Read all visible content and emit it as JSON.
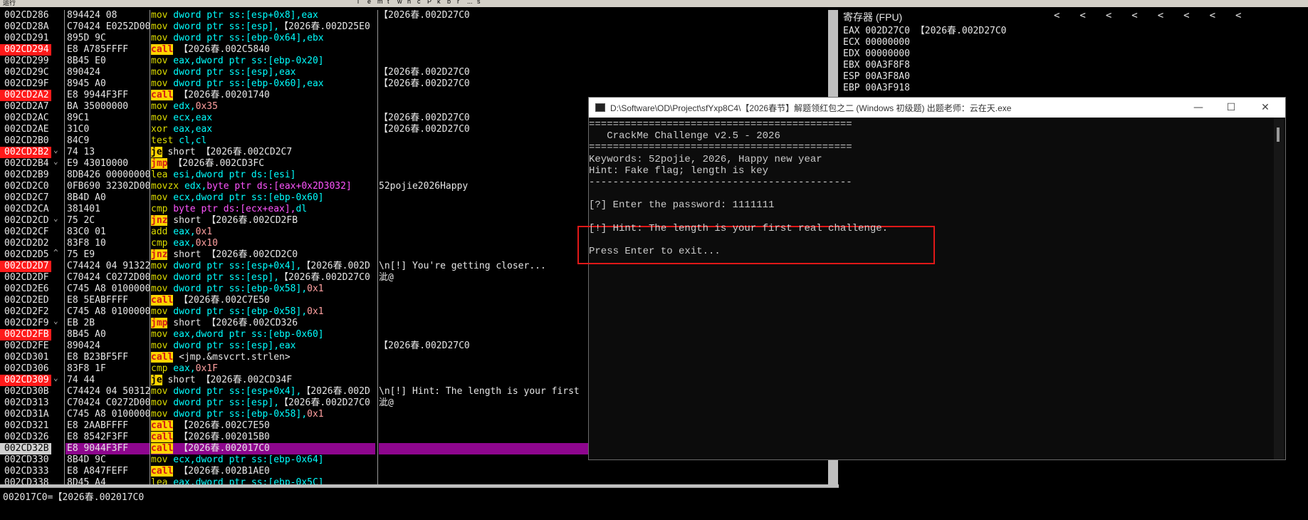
{
  "toolbar": {
    "mode_label": "运行",
    "letters": [
      "l",
      "e",
      "m",
      "t",
      "w",
      "h",
      "c",
      "P",
      "k",
      "b",
      "r",
      "...",
      "s"
    ]
  },
  "cpu": {
    "rows": [
      {
        "addr": "002CD286",
        "hex": "894424 08",
        "bp": false,
        "mark": "",
        "dis": [
          [
            "mn",
            "mov"
          ],
          [
            "op",
            " dword ptr ss:[esp+0x8],"
          ],
          [
            "op",
            "eax"
          ]
        ],
        "comment": "【2026春.002D27C0"
      },
      {
        "addr": "002CD28A",
        "hex": "C70424 E0252D00",
        "bp": false,
        "mark": "",
        "dis": [
          [
            "mn",
            "mov"
          ],
          [
            "op",
            " dword ptr ss:[esp],"
          ],
          [
            "str",
            "【2026春.002D25E0"
          ]
        ],
        "comment": ""
      },
      {
        "addr": "002CD291",
        "hex": "895D 9C",
        "bp": false,
        "mark": "",
        "dis": [
          [
            "mn",
            "mov"
          ],
          [
            "op",
            " dword ptr ss:[ebp-0x64],"
          ],
          [
            "op",
            "ebx"
          ]
        ],
        "comment": ""
      },
      {
        "addr": "002CD294",
        "hex": "E8 A785FFFF",
        "bp": true,
        "mark": "",
        "dis": [
          [
            "call",
            "call"
          ],
          [
            "str",
            " 【2026春.002C5840"
          ]
        ],
        "comment": ""
      },
      {
        "addr": "002CD299",
        "hex": "8B45 E0",
        "bp": false,
        "mark": "",
        "dis": [
          [
            "mn",
            "mov"
          ],
          [
            "op",
            " eax,dword ptr ss:[ebp-0x20]"
          ]
        ],
        "comment": ""
      },
      {
        "addr": "002CD29C",
        "hex": "890424",
        "bp": false,
        "mark": "",
        "dis": [
          [
            "mn",
            "mov"
          ],
          [
            "op",
            " dword ptr ss:[esp],"
          ],
          [
            "op",
            "eax"
          ]
        ],
        "comment": "【2026春.002D27C0"
      },
      {
        "addr": "002CD29F",
        "hex": "8945 A0",
        "bp": false,
        "mark": "",
        "dis": [
          [
            "mn",
            "mov"
          ],
          [
            "op",
            " dword ptr ss:[ebp-0x60],"
          ],
          [
            "op",
            "eax"
          ]
        ],
        "comment": "【2026春.002D27C0"
      },
      {
        "addr": "002CD2A2",
        "hex": "E8 9944F3FF",
        "bp": true,
        "mark": "",
        "dis": [
          [
            "call",
            "call"
          ],
          [
            "str",
            " 【2026春.00201740"
          ]
        ],
        "comment": ""
      },
      {
        "addr": "002CD2A7",
        "hex": "BA 35000000",
        "bp": false,
        "mark": "",
        "dis": [
          [
            "mn",
            "mov"
          ],
          [
            "op",
            " edx,"
          ],
          [
            "imm",
            "0x35"
          ]
        ],
        "comment": ""
      },
      {
        "addr": "002CD2AC",
        "hex": "89C1",
        "bp": false,
        "mark": "",
        "dis": [
          [
            "mn",
            "mov"
          ],
          [
            "op",
            " ecx,eax"
          ]
        ],
        "comment": "【2026春.002D27C0"
      },
      {
        "addr": "002CD2AE",
        "hex": "31C0",
        "bp": false,
        "mark": "",
        "dis": [
          [
            "mn",
            "xor"
          ],
          [
            "op",
            " eax,eax"
          ]
        ],
        "comment": "【2026春.002D27C0"
      },
      {
        "addr": "002CD2B0",
        "hex": "84C9",
        "bp": false,
        "mark": "",
        "dis": [
          [
            "mn",
            "test"
          ],
          [
            "op",
            " cl,cl"
          ]
        ],
        "comment": ""
      },
      {
        "addr": "002CD2B2",
        "hex": "74 13",
        "bp": true,
        "mark": "⌄",
        "dis": [
          [
            "je",
            "je"
          ],
          [
            "str",
            " short 【2026春.002CD2C7"
          ]
        ],
        "comment": ""
      },
      {
        "addr": "002CD2B4",
        "hex": "E9 43010000",
        "bp": false,
        "mark": "⌄",
        "dis": [
          [
            "jmp",
            "jmp"
          ],
          [
            "str",
            " 【2026春.002CD3FC"
          ]
        ],
        "comment": ""
      },
      {
        "addr": "002CD2B9",
        "hex": "8DB426 00000000",
        "bp": false,
        "mark": "",
        "dis": [
          [
            "mn",
            "lea"
          ],
          [
            "op",
            " esi,dword ptr ds:[esi]"
          ]
        ],
        "comment": ""
      },
      {
        "addr": "002CD2C0",
        "hex": "0FB690 32302D00",
        "bp": false,
        "mark": "",
        "dis": [
          [
            "mn",
            "movzx"
          ],
          [
            "op",
            " edx,"
          ],
          [
            "mag",
            "byte ptr ds:[eax+0x2D3032]"
          ]
        ],
        "comment": "52pojie2026Happy"
      },
      {
        "addr": "002CD2C7",
        "hex": "8B4D A0",
        "bp": false,
        "mark": "",
        "dis": [
          [
            "mn",
            "mov"
          ],
          [
            "op",
            " ecx,dword ptr ss:[ebp-0x60]"
          ]
        ],
        "comment": ""
      },
      {
        "addr": "002CD2CA",
        "hex": "381401",
        "bp": false,
        "mark": "",
        "dis": [
          [
            "mn",
            "cmp"
          ],
          [
            "mag",
            " byte ptr ds:[ecx+eax],"
          ],
          [
            "op",
            "dl"
          ]
        ],
        "comment": ""
      },
      {
        "addr": "002CD2CD",
        "hex": "75 2C",
        "bp": false,
        "mark": "⌄",
        "dis": [
          [
            "jmp",
            "jnz"
          ],
          [
            "str",
            " short 【2026春.002CD2FB"
          ]
        ],
        "comment": ""
      },
      {
        "addr": "002CD2CF",
        "hex": "83C0 01",
        "bp": false,
        "mark": "",
        "dis": [
          [
            "mn",
            "add"
          ],
          [
            "op",
            " eax,"
          ],
          [
            "imm",
            "0x1"
          ]
        ],
        "comment": ""
      },
      {
        "addr": "002CD2D2",
        "hex": "83F8 10",
        "bp": false,
        "mark": "",
        "dis": [
          [
            "mn",
            "cmp"
          ],
          [
            "op",
            " eax,"
          ],
          [
            "imm",
            "0x10"
          ]
        ],
        "comment": ""
      },
      {
        "addr": "002CD2D5",
        "hex": "75 E9",
        "bp": false,
        "mark": "^",
        "dis": [
          [
            "jmp",
            "jnz"
          ],
          [
            "str",
            " short 【2026春.002CD2C0"
          ]
        ],
        "comment": ""
      },
      {
        "addr": "002CD2D7",
        "hex": "C74424 04 91322D",
        "bp": true,
        "mark": "",
        "dis": [
          [
            "mn",
            "mov"
          ],
          [
            "op",
            " dword ptr ss:[esp+0x4],"
          ],
          [
            "str",
            "【2026春.002D"
          ]
        ],
        "comment": "\\n[!] You're getting closer..."
      },
      {
        "addr": "002CD2DF",
        "hex": "C70424 C0272D00",
        "bp": false,
        "mark": "",
        "dis": [
          [
            "mn",
            "mov"
          ],
          [
            "op",
            " dword ptr ss:[esp],"
          ],
          [
            "str",
            "【2026春.002D27C0"
          ]
        ],
        "comment": "泚@"
      },
      {
        "addr": "002CD2E6",
        "hex": "C745 A8 01000000",
        "bp": false,
        "mark": "",
        "dis": [
          [
            "mn",
            "mov"
          ],
          [
            "op",
            " dword ptr ss:[ebp-0x58],"
          ],
          [
            "imm",
            "0x1"
          ]
        ],
        "comment": ""
      },
      {
        "addr": "002CD2ED",
        "hex": "E8 5EABFFFF",
        "bp": false,
        "mark": "",
        "dis": [
          [
            "call",
            "call"
          ],
          [
            "str",
            " 【2026春.002C7E50"
          ]
        ],
        "comment": ""
      },
      {
        "addr": "002CD2F2",
        "hex": "C745 A8 01000000",
        "bp": false,
        "mark": "",
        "dis": [
          [
            "mn",
            "mov"
          ],
          [
            "op",
            " dword ptr ss:[ebp-0x58],"
          ],
          [
            "imm",
            "0x1"
          ]
        ],
        "comment": ""
      },
      {
        "addr": "002CD2F9",
        "hex": "EB 2B",
        "bp": false,
        "mark": "⌄",
        "dis": [
          [
            "jmp",
            "jmp"
          ],
          [
            "str",
            " short 【2026春.002CD326"
          ]
        ],
        "comment": ""
      },
      {
        "addr": "002CD2FB",
        "hex": "8B45 A0",
        "bp": true,
        "mark": "",
        "dis": [
          [
            "mn",
            "mov"
          ],
          [
            "op",
            " eax,dword ptr ss:[ebp-0x60]"
          ]
        ],
        "comment": ""
      },
      {
        "addr": "002CD2FE",
        "hex": "890424",
        "bp": false,
        "mark": "",
        "dis": [
          [
            "mn",
            "mov"
          ],
          [
            "op",
            " dword ptr ss:[esp],"
          ],
          [
            "op",
            "eax"
          ]
        ],
        "comment": "【2026春.002D27C0"
      },
      {
        "addr": "002CD301",
        "hex": "E8 B23BF5FF",
        "bp": false,
        "mark": "",
        "dis": [
          [
            "call",
            "call"
          ],
          [
            "str",
            " <jmp.&msvcrt.strlen>"
          ]
        ],
        "comment": ""
      },
      {
        "addr": "002CD306",
        "hex": "83F8 1F",
        "bp": false,
        "mark": "",
        "dis": [
          [
            "mn",
            "cmp"
          ],
          [
            "op",
            " eax,"
          ],
          [
            "imm",
            "0x1F"
          ]
        ],
        "comment": ""
      },
      {
        "addr": "002CD309",
        "hex": "74 44",
        "bp": true,
        "mark": "⌄",
        "dis": [
          [
            "je",
            "je"
          ],
          [
            "str",
            " short 【2026春.002CD34F"
          ]
        ],
        "comment": ""
      },
      {
        "addr": "002CD30B",
        "hex": "C74424 04 503120",
        "bp": false,
        "mark": "",
        "dis": [
          [
            "mn",
            "mov"
          ],
          [
            "op",
            " dword ptr ss:[esp+0x4],"
          ],
          [
            "str",
            "【2026春.002D"
          ]
        ],
        "comment": "\\n[!] Hint: The length is your first"
      },
      {
        "addr": "002CD313",
        "hex": "C70424 C0272D00",
        "bp": false,
        "mark": "",
        "dis": [
          [
            "mn",
            "mov"
          ],
          [
            "op",
            " dword ptr ss:[esp],"
          ],
          [
            "str",
            "【2026春.002D27C0"
          ]
        ],
        "comment": "泚@"
      },
      {
        "addr": "002CD31A",
        "hex": "C745 A8 01000000",
        "bp": false,
        "mark": "",
        "dis": [
          [
            "mn",
            "mov"
          ],
          [
            "op",
            " dword ptr ss:[ebp-0x58],"
          ],
          [
            "imm",
            "0x1"
          ]
        ],
        "comment": ""
      },
      {
        "addr": "002CD321",
        "hex": "E8 2AABFFFF",
        "bp": false,
        "mark": "",
        "dis": [
          [
            "call",
            "call"
          ],
          [
            "str",
            " 【2026春.002C7E50"
          ]
        ],
        "comment": ""
      },
      {
        "addr": "002CD326",
        "hex": "E8 8542F3FF",
        "bp": false,
        "mark": "",
        "dis": [
          [
            "call",
            "call"
          ],
          [
            "str",
            " 【2026春.002015B0"
          ]
        ],
        "comment": ""
      },
      {
        "addr": "002CD32B",
        "hex": "E8 9044F3FF",
        "bp": false,
        "mark": "",
        "sel": true,
        "dis": [
          [
            "call",
            "call"
          ],
          [
            "str",
            " 【2026春.002017C0"
          ]
        ],
        "comment": ""
      },
      {
        "addr": "002CD330",
        "hex": "8B4D 9C",
        "bp": false,
        "mark": "",
        "dis": [
          [
            "mn",
            "mov"
          ],
          [
            "op",
            " ecx,dword ptr ss:[ebp-0x64]"
          ]
        ],
        "comment": ""
      },
      {
        "addr": "002CD333",
        "hex": "E8 A847FEFF",
        "bp": false,
        "mark": "",
        "dis": [
          [
            "call",
            "call"
          ],
          [
            "str",
            " 【2026春.002B1AE0"
          ]
        ],
        "comment": ""
      },
      {
        "addr": "002CD338",
        "hex": "8D45 A4",
        "bp": false,
        "mark": "",
        "dis": [
          [
            "mn",
            "lea"
          ],
          [
            "op",
            " eax,dword ptr ss:[ebp-0x5C]"
          ]
        ],
        "comment": ""
      }
    ]
  },
  "info": {
    "line": "002017C0=【2026春.002017C0"
  },
  "registers": {
    "title": "寄存器 (FPU)",
    "arrows": "<<<<<<<<",
    "rows": [
      {
        "name": "EAX",
        "value": "002D27C0 【2026春.002D27C0"
      },
      {
        "name": "ECX",
        "value": "00000000"
      },
      {
        "name": "EDX",
        "value": "00000000"
      },
      {
        "name": "EBX",
        "value": "00A3F8F8"
      },
      {
        "name": "ESP",
        "value": "00A3F8A0"
      },
      {
        "name": "EBP",
        "value": "00A3F918"
      }
    ]
  },
  "console": {
    "title": "D:\\Software\\OD\\Project\\sfYxp8C4\\【2026春节】解题领红包之二 (Windows 初级题) 出题老师：云在天.exe",
    "min": "—",
    "max": "☐",
    "close": "✕",
    "lines": [
      "============================================",
      "   CrackMe Challenge v2.5 - 2026",
      "============================================",
      "Keywords: 52pojie, 2026, Happy new year",
      "Hint: Fake flag; length is key",
      "--------------------------------------------",
      "",
      "[?] Enter the password: 1111111",
      "",
      "[!] Hint: The length is your first real challenge.",
      "",
      "Press Enter to exit..."
    ]
  }
}
